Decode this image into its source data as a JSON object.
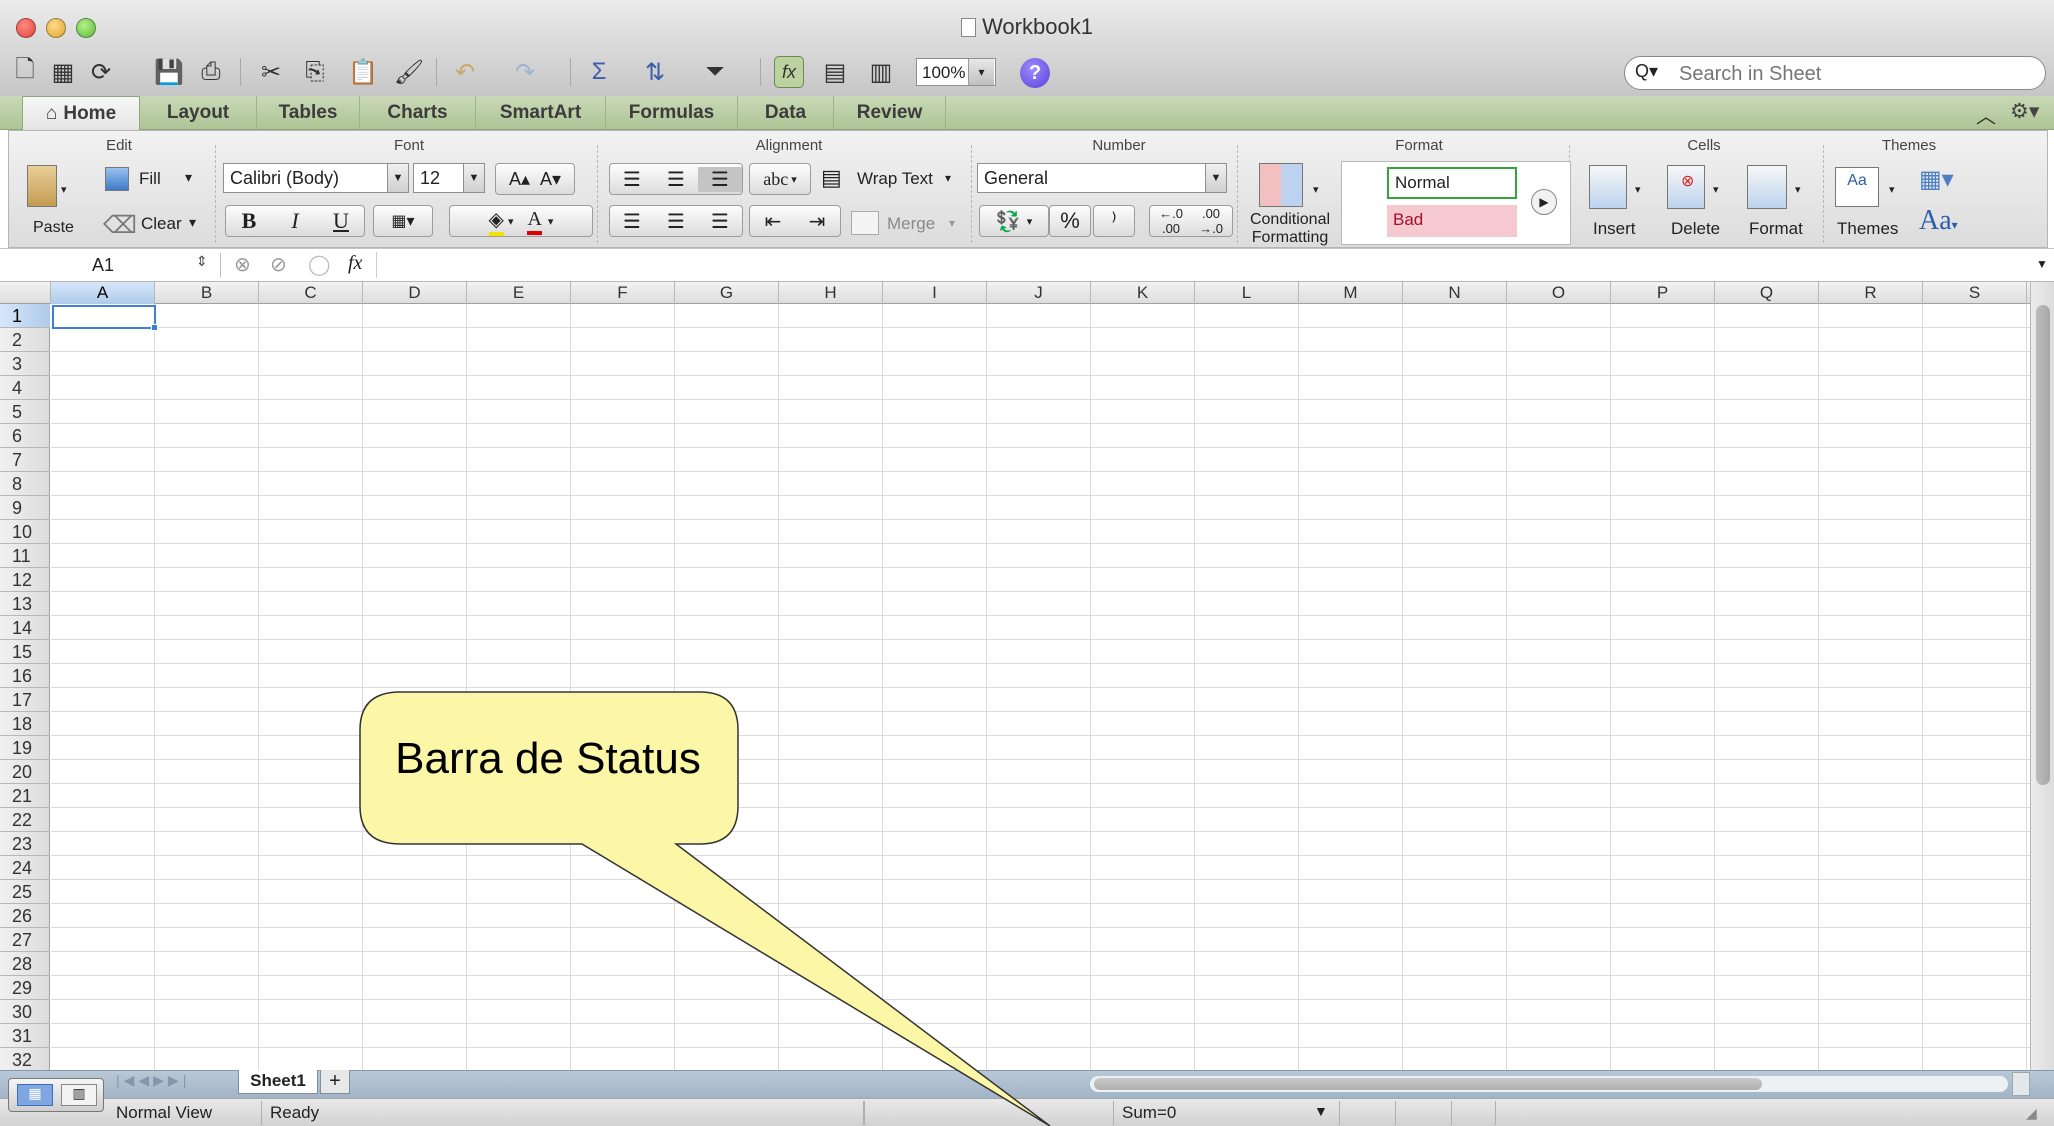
{
  "window": {
    "title": "Workbook1"
  },
  "toolbar": {
    "zoom": "100%",
    "zoom_arrow": "▾",
    "search_placeholder": "Search in Sheet",
    "help": "?",
    "search_glyph": "Q▾"
  },
  "ribbon_tabs": [
    {
      "label": "Home",
      "icon": "home-icon",
      "glyph": "⌂"
    },
    {
      "label": "Layout"
    },
    {
      "label": "Tables"
    },
    {
      "label": "Charts"
    },
    {
      "label": "SmartArt"
    },
    {
      "label": "Formulas"
    },
    {
      "label": "Data"
    },
    {
      "label": "Review"
    }
  ],
  "ribbon": {
    "groups": {
      "edit": "Edit",
      "font": "Font",
      "alignment": "Alignment",
      "number": "Number",
      "format": "Format",
      "cells": "Cells",
      "themes": "Themes"
    },
    "edit": {
      "paste": "Paste",
      "fill": "Fill",
      "clear": "Clear",
      "fill_arrow": "▾",
      "clear_arrow": "▾"
    },
    "font": {
      "name": "Calibri (Body)",
      "size": "12",
      "bold": "B",
      "italic": "I",
      "underline": "U",
      "grow": "A▴",
      "shrink": "A▾",
      "color": "A"
    },
    "alignment": {
      "wrap": "Wrap Text",
      "merge": "Merge",
      "orientation": "abc"
    },
    "number": {
      "format": "General",
      "percent": "%",
      "comma": "⁾",
      "increase": "←.0 .00",
      "decrease": ".00 →.0"
    },
    "format": {
      "conditional_line1": "Conditional",
      "conditional_line2": "Formatting",
      "style_normal": "Normal",
      "style_bad": "Bad"
    },
    "cells": {
      "insert": "Insert",
      "delete": "Delete",
      "format": "Format"
    },
    "themes": {
      "themes": "Themes",
      "fonts": "Aa",
      "thumb": "Aa"
    }
  },
  "formula_bar": {
    "cell_ref": "A1",
    "fx": "fx",
    "value": ""
  },
  "sheet": {
    "columns": [
      "A",
      "B",
      "C",
      "D",
      "E",
      "F",
      "G",
      "H",
      "I",
      "J",
      "K",
      "L",
      "M",
      "N",
      "O",
      "P",
      "Q",
      "R",
      "S"
    ],
    "rows": [
      "1",
      "2",
      "3",
      "4",
      "5",
      "6",
      "7",
      "8",
      "9",
      "10",
      "11",
      "12",
      "13",
      "14",
      "15",
      "16",
      "17",
      "18",
      "19",
      "20",
      "21",
      "22",
      "23",
      "24",
      "25",
      "26",
      "27",
      "28",
      "29",
      "30",
      "31",
      "32"
    ],
    "selected_cell": "A1",
    "tabs": [
      {
        "label": "Sheet1"
      }
    ],
    "add_sheet": "+"
  },
  "status_bar": {
    "view": "Normal View",
    "state": "Ready",
    "sum": "Sum=0"
  },
  "callout": {
    "text": "Barra de Status"
  },
  "colors": {
    "callout_fill": "#fbf7a6",
    "ribbon_tab_bg": "#b9cfa4",
    "selection": "#3f7fd1",
    "bad_style": "#f6c8cf",
    "normal_style_border": "#37a43b"
  }
}
